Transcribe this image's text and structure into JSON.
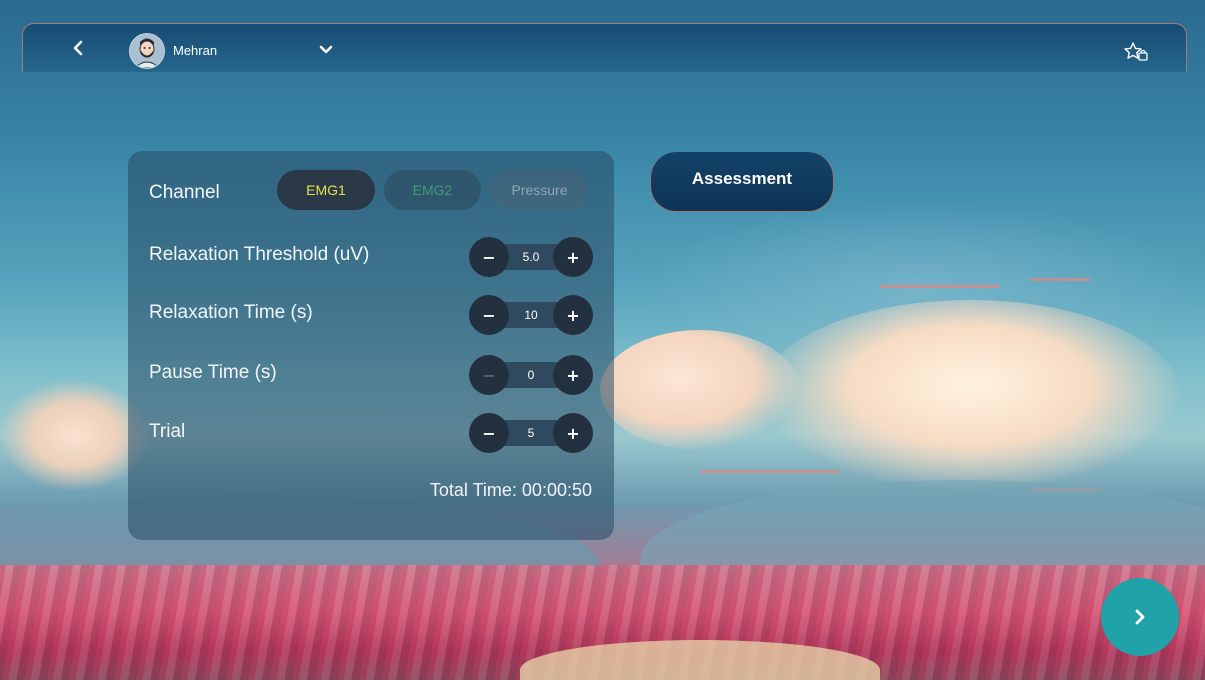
{
  "header": {
    "username": "Mehran",
    "icons": [
      "back-icon",
      "avatar",
      "chevron-down-icon",
      "favorite-star-icon"
    ]
  },
  "panel": {
    "channel": {
      "label": "Channel",
      "options": [
        "EMG1",
        "EMG2",
        "Pressure"
      ],
      "selected": "EMG1"
    },
    "settings": [
      {
        "label": "Relaxation Threshold (uV)",
        "value": "5.0"
      },
      {
        "label": "Relaxation Time (s)",
        "value": "10"
      },
      {
        "label": "Pause Time (s)",
        "value": "0"
      },
      {
        "label": "Trial",
        "value": "5"
      }
    ],
    "stepper_minus": "−",
    "stepper_plus": "+",
    "total_time": "Total Time: 00:00:50"
  },
  "actions": {
    "assessment_label": "Assessment",
    "next_icon": "chevron-right-icon"
  },
  "colors": {
    "selected_channel_text": "#e4e24a",
    "emg2_text": "#3f9a7a",
    "next_button": "#1fa3a9",
    "assessment_button": "#134268"
  }
}
